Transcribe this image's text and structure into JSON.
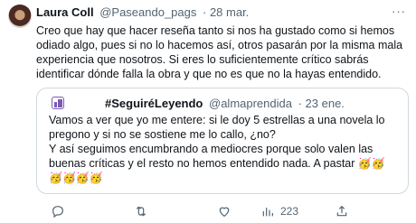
{
  "tweet": {
    "author_name": "Laura Coll",
    "author_handle": "@Paseando_pags",
    "date": "· 28 mar.",
    "more": "···",
    "text": "Creo que hay que hacer reseña tanto si nos ha gustado como si hemos odiado algo, pues si no lo hacemos así, otros pasarán por la misma mala experiencia que nosotros. Si eres lo suficientemente crítico sabrás identificar dónde falla la obra y que no es que no la hayas entendido."
  },
  "quote": {
    "author_name": "#SeguiréLeyendo",
    "author_handle": "@almaprendida",
    "date": "· 23 ene.",
    "text": "Vamos a ver que yo me entere: si le doy 5 estrellas a una novela lo pregono y si no se sostiene me lo callo, ¿no?\nY así seguimos encumbrando a mediocres porque solo valen las buenas críticas y el resto no hemos entendido nada. A pastar",
    "emojis_inline": "🥳🥳",
    "emojis_line": "🥳🥳🥳🥳"
  },
  "actions": {
    "reply_icon": "reply-icon",
    "retweet_icon": "retweet-icon",
    "like_icon": "like-icon",
    "views_icon": "views-icon",
    "views_count": "223",
    "share_icon": "share-icon"
  },
  "colors": {
    "secondary_text": "#536471",
    "border": "#cfd9de",
    "text": "#0f1419"
  }
}
